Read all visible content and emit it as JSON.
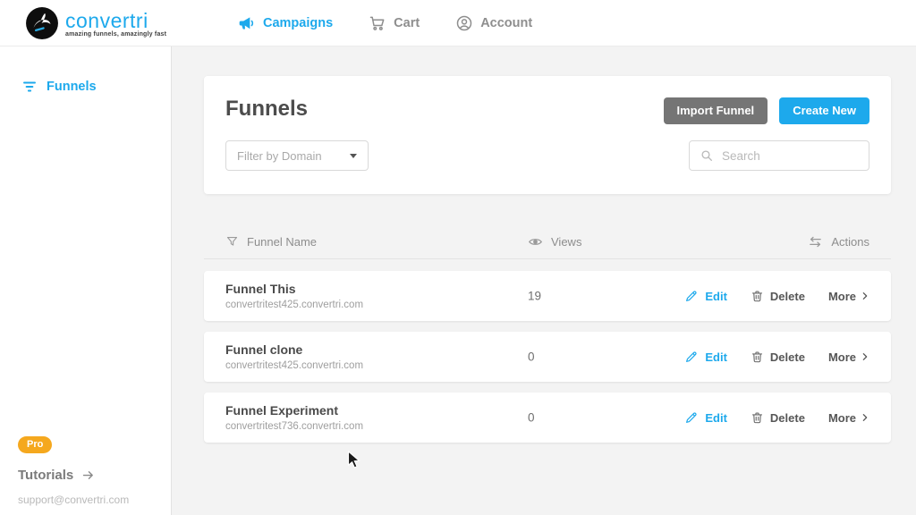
{
  "brand": {
    "name": "convertri",
    "tagline": "amazing funnels, amazingly fast"
  },
  "nav": {
    "campaigns": "Campaigns",
    "cart": "Cart",
    "account": "Account"
  },
  "sidebar": {
    "funnels": "Funnels",
    "pro_badge": "Pro",
    "tutorials": "Tutorials",
    "support_email": "support@convertri.com"
  },
  "panel": {
    "title": "Funnels",
    "import_button": "Import Funnel",
    "create_button": "Create New",
    "filter_placeholder": "Filter by Domain",
    "search_placeholder": "Search"
  },
  "table": {
    "columns": {
      "name": "Funnel Name",
      "views": "Views",
      "actions": "Actions"
    },
    "rows": [
      {
        "name": "Funnel This",
        "domain": "convertritest425.convertri.com",
        "views": "19"
      },
      {
        "name": "Funnel clone",
        "domain": "convertritest425.convertri.com",
        "views": "0"
      },
      {
        "name": "Funnel Experiment",
        "domain": "convertritest736.convertri.com",
        "views": "0"
      }
    ],
    "row_actions": {
      "edit": "Edit",
      "delete": "Delete",
      "more": "More"
    }
  },
  "colors": {
    "accent_blue": "#1da9ec",
    "button_gray": "#757575",
    "pro_yellow": "#f5a81e"
  }
}
